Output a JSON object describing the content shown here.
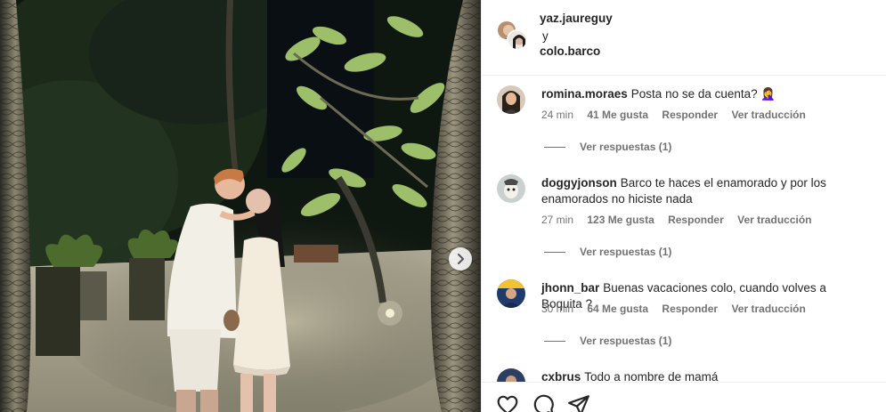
{
  "header": {
    "user1": "yaz.jaureguy",
    "conjunction": "y",
    "user2": "colo.barco"
  },
  "comments": [
    {
      "username": "romina.moraes",
      "text": "Posta no se da cuenta? 🤦‍♀️",
      "time": "24 min",
      "likes": "41 Me gusta",
      "reply_label": "Responder",
      "translate_label": "Ver traducción",
      "view_replies": "Ver respuestas (1)"
    },
    {
      "username": "doggyjonson",
      "text": "Barco te haces el enamorado y por los enamorados no hiciste nada",
      "time": "27 min",
      "likes": "123 Me gusta",
      "reply_label": "Responder",
      "translate_label": "Ver traducción",
      "view_replies": "Ver respuestas (1)"
    },
    {
      "username": "jhonn_bar",
      "text": "Buenas vacaciones colo, cuando volves a Boquita ?",
      "time": "30 min",
      "likes": "64 Me gusta",
      "reply_label": "Responder",
      "translate_label": "Ver traducción",
      "view_replies": "Ver respuestas (1)"
    },
    {
      "username": "cxbrus",
      "text": "Todo a nombre de mamá"
    }
  ],
  "icons": {
    "like": "heart-icon",
    "comment": "comment-icon",
    "share": "paper-plane-icon",
    "next": "chevron-right-icon"
  },
  "colors": {
    "text": "#262626",
    "secondary": "#737373",
    "divider": "#efefef"
  }
}
